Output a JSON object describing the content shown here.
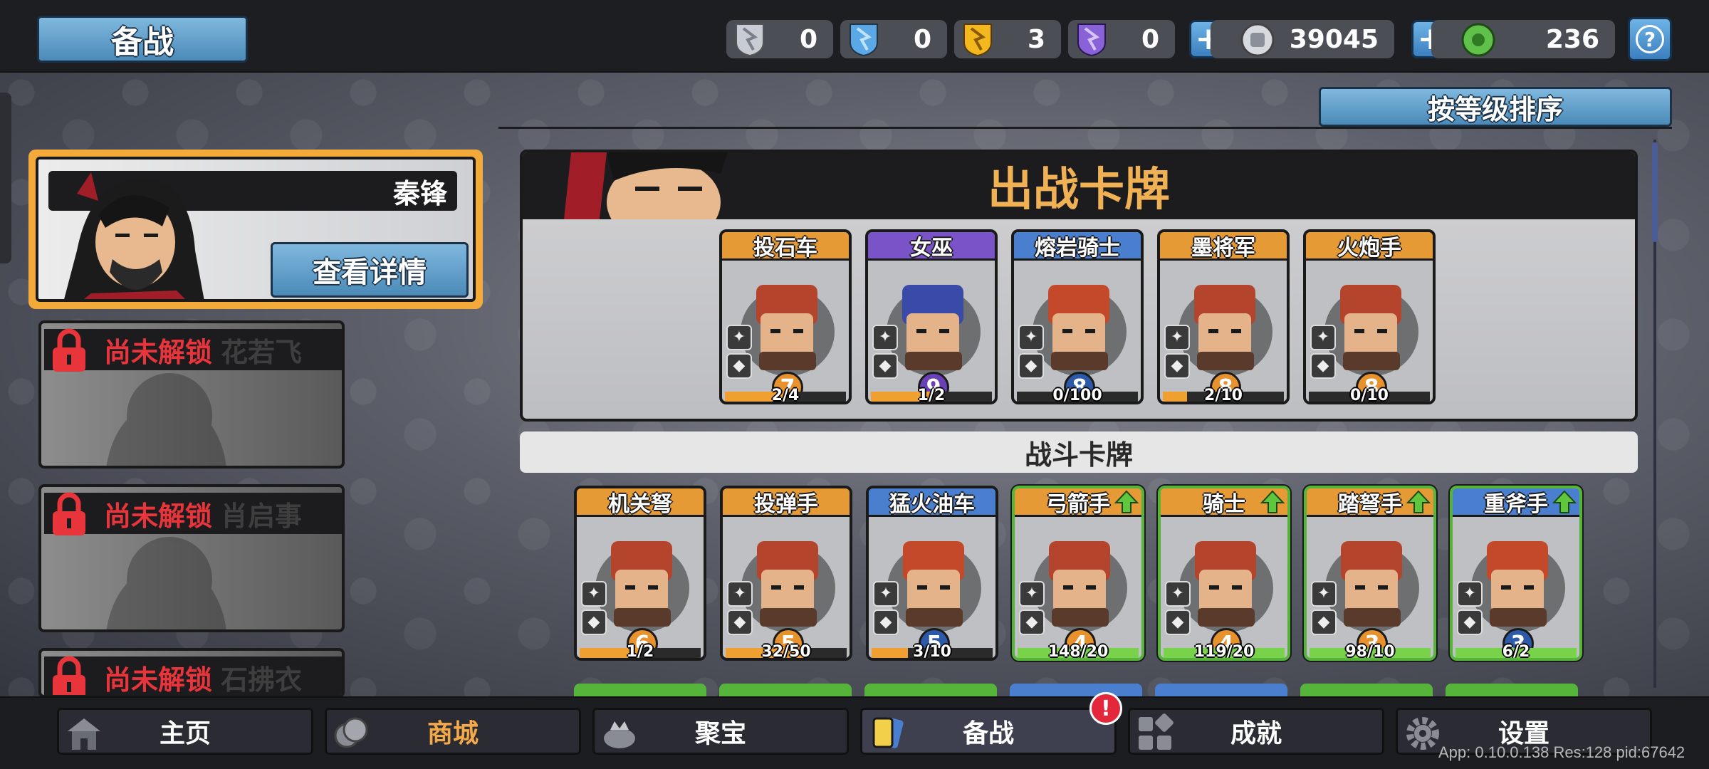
{
  "header": {
    "title": "备战",
    "resources": [
      {
        "name": "silver-shard",
        "value": "0",
        "color": "#c8ccd4"
      },
      {
        "name": "blue-shard",
        "value": "0",
        "color": "#5aa8e6"
      },
      {
        "name": "gold-shard",
        "value": "3",
        "color": "#f2b81e"
      },
      {
        "name": "purple-shard",
        "value": "0",
        "color": "#8a62d8"
      }
    ],
    "coins": "39045",
    "gems": "236"
  },
  "sort_label": "按等级排序",
  "hero": {
    "selected_name": "秦锋",
    "detail_label": "查看详情",
    "locked": [
      {
        "status": "尚未解锁",
        "name": "花若飞"
      },
      {
        "status": "尚未解锁",
        "name": "肖启事"
      },
      {
        "status": "尚未解锁",
        "name": "石拂衣"
      }
    ]
  },
  "deck": {
    "title": "出战卡牌",
    "cards": [
      {
        "name": "投石车",
        "cost": "7",
        "progress": "2/4",
        "fill": 0.5,
        "rarity": "orange"
      },
      {
        "name": "女巫",
        "cost": "9",
        "progress": "1/2",
        "fill": 0.5,
        "rarity": "purple"
      },
      {
        "name": "熔岩骑士",
        "cost": "8",
        "progress": "0/100",
        "fill": 0.0,
        "rarity": "blue"
      },
      {
        "name": "墨将军",
        "cost": "8",
        "progress": "2/10",
        "fill": 0.2,
        "rarity": "orange"
      },
      {
        "name": "火炮手",
        "cost": "8",
        "progress": "0/10",
        "fill": 0.0,
        "rarity": "orange"
      }
    ]
  },
  "battle": {
    "title": "战斗卡牌",
    "cards": [
      {
        "name": "机关弩",
        "cost": "6",
        "progress": "1/2",
        "fill": 0.5,
        "rarity": "orange"
      },
      {
        "name": "投弹手",
        "cost": "5",
        "progress": "32/50",
        "fill": 0.64,
        "rarity": "orange"
      },
      {
        "name": "猛火油车",
        "cost": "5",
        "progress": "3/10",
        "fill": 0.3,
        "rarity": "blue"
      },
      {
        "name": "弓箭手",
        "cost": "4",
        "progress": "148/20",
        "fill": 1.0,
        "rarity": "orange",
        "upgrade": true
      },
      {
        "name": "骑士",
        "cost": "4",
        "progress": "119/20",
        "fill": 1.0,
        "rarity": "orange",
        "upgrade": true
      },
      {
        "name": "踏弩手",
        "cost": "3",
        "progress": "98/10",
        "fill": 1.0,
        "rarity": "orange",
        "upgrade": true
      },
      {
        "name": "重斧手",
        "cost": "3",
        "progress": "6/2",
        "fill": 1.0,
        "rarity": "blue",
        "upgrade": true
      }
    ]
  },
  "nav": {
    "items": [
      {
        "label": "主页",
        "icon": "home-icon"
      },
      {
        "label": "商城",
        "icon": "shop-icon"
      },
      {
        "label": "聚宝",
        "icon": "treasure-icon"
      },
      {
        "label": "备战",
        "icon": "card-icon"
      },
      {
        "label": "成就",
        "icon": "achievement-icon"
      },
      {
        "label": "设置",
        "icon": "gear-icon"
      }
    ],
    "alert": "!"
  },
  "build_info": "App: 0.10.0.138 Res:128 pid:67642"
}
